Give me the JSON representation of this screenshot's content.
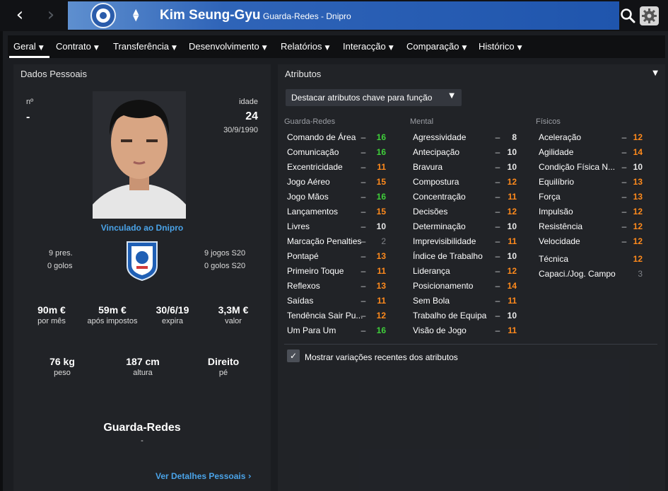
{
  "header": {
    "back_icon": "‹",
    "forward_icon": "›",
    "player_name": "Kim Seung-Gyu",
    "player_subtitle": "Guarda-Redes - Dnipro"
  },
  "tabs": [
    {
      "label": "Geral"
    },
    {
      "label": "Contrato"
    },
    {
      "label": "Transferência"
    },
    {
      "label": "Desenvolvimento"
    },
    {
      "label": "Relatórios"
    },
    {
      "label": "Interacção"
    },
    {
      "label": "Comparação"
    },
    {
      "label": "Histórico"
    }
  ],
  "personal": {
    "panel_title": "Dados Pessoais",
    "number_label": "nº",
    "number_value": "-",
    "age_label": "idade",
    "age_value": "24",
    "birth_date": "30/9/1990",
    "linked_label": "Vinculado ao Dnipro",
    "caps": "9 pres.",
    "goals": "0 golos",
    "u20_caps": "9 jogos S20",
    "u20_goals": "0 golos S20",
    "wage_value": "90m €",
    "wage_label": "por mês",
    "wage_net_value": "59m €",
    "wage_net_label": "após impostos",
    "expires_value": "30/6/19",
    "expires_label": "expira",
    "value_value": "3,3M €",
    "value_label": "valor",
    "weight_value": "76 kg",
    "weight_label": "peso",
    "height_value": "187 cm",
    "height_label": "altura",
    "foot_value": "Direito",
    "foot_label": "pé",
    "position": "Guarda-Redes",
    "position_sub": "-",
    "details_link": "Ver Detalhes Pessoais"
  },
  "attributes": {
    "panel_title": "Atributos",
    "highlight_dropdown": "Destacar atributos chave para função",
    "dash": "–",
    "columns": [
      {
        "heading": "Guarda-Redes",
        "items": [
          {
            "name": "Comando de Área",
            "value": "16",
            "color": "green"
          },
          {
            "name": "Comunicação",
            "value": "16",
            "color": "green"
          },
          {
            "name": "Excentricidade",
            "value": "11",
            "color": "orange"
          },
          {
            "name": "Jogo Aéreo",
            "value": "15",
            "color": "orange"
          },
          {
            "name": "Jogo Mãos",
            "value": "16",
            "color": "green"
          },
          {
            "name": "Lançamentos",
            "value": "15",
            "color": "orange"
          },
          {
            "name": "Livres",
            "value": "10",
            "color": "white"
          },
          {
            "name": "Marcação Penalties",
            "value": "2",
            "color": "grey"
          },
          {
            "name": "Pontapé",
            "value": "13",
            "color": "orange"
          },
          {
            "name": "Primeiro Toque",
            "value": "11",
            "color": "orange"
          },
          {
            "name": "Reflexos",
            "value": "13",
            "color": "orange"
          },
          {
            "name": "Saídas",
            "value": "11",
            "color": "orange"
          },
          {
            "name": "Tendência Sair Pu...",
            "value": "12",
            "color": "orange"
          },
          {
            "name": "Um Para Um",
            "value": "16",
            "color": "green"
          }
        ]
      },
      {
        "heading": "Mental",
        "items": [
          {
            "name": "Agressividade",
            "value": "8",
            "color": "white"
          },
          {
            "name": "Antecipação",
            "value": "10",
            "color": "white"
          },
          {
            "name": "Bravura",
            "value": "10",
            "color": "white"
          },
          {
            "name": "Compostura",
            "value": "12",
            "color": "orange"
          },
          {
            "name": "Concentração",
            "value": "11",
            "color": "orange"
          },
          {
            "name": "Decisões",
            "value": "12",
            "color": "orange"
          },
          {
            "name": "Determinação",
            "value": "10",
            "color": "white"
          },
          {
            "name": "Imprevisibilidade",
            "value": "11",
            "color": "orange"
          },
          {
            "name": "Índice de Trabalho",
            "value": "10",
            "color": "white"
          },
          {
            "name": "Liderança",
            "value": "12",
            "color": "orange"
          },
          {
            "name": "Posicionamento",
            "value": "14",
            "color": "orange"
          },
          {
            "name": "Sem Bola",
            "value": "11",
            "color": "orange"
          },
          {
            "name": "Trabalho de Equipa",
            "value": "10",
            "color": "white"
          },
          {
            "name": "Visão de Jogo",
            "value": "11",
            "color": "orange"
          }
        ]
      },
      {
        "heading": "Físicos",
        "items": [
          {
            "name": "Aceleração",
            "value": "12",
            "color": "orange"
          },
          {
            "name": "Agilidade",
            "value": "14",
            "color": "orange"
          },
          {
            "name": "Condição Física N...",
            "value": "10",
            "color": "white"
          },
          {
            "name": "Equilíbrio",
            "value": "13",
            "color": "orange"
          },
          {
            "name": "Força",
            "value": "13",
            "color": "orange"
          },
          {
            "name": "Impulsão",
            "value": "12",
            "color": "orange"
          },
          {
            "name": "Resistência",
            "value": "12",
            "color": "orange"
          },
          {
            "name": "Velocidade",
            "value": "12",
            "color": "orange"
          }
        ],
        "extra": [
          {
            "name": "Técnica",
            "value": "12",
            "color": "orange"
          },
          {
            "name": "Capaci./Jog. Campo",
            "value": "3",
            "color": "grey"
          }
        ]
      }
    ],
    "show_changes_label": "Mostrar variações recentes dos atributos",
    "show_changes_checked": true
  },
  "colors": {
    "accent_blue": "#2f64b8",
    "link_blue": "#4aa3e8",
    "green": "#3fcf3a",
    "orange": "#ff8a1c"
  }
}
